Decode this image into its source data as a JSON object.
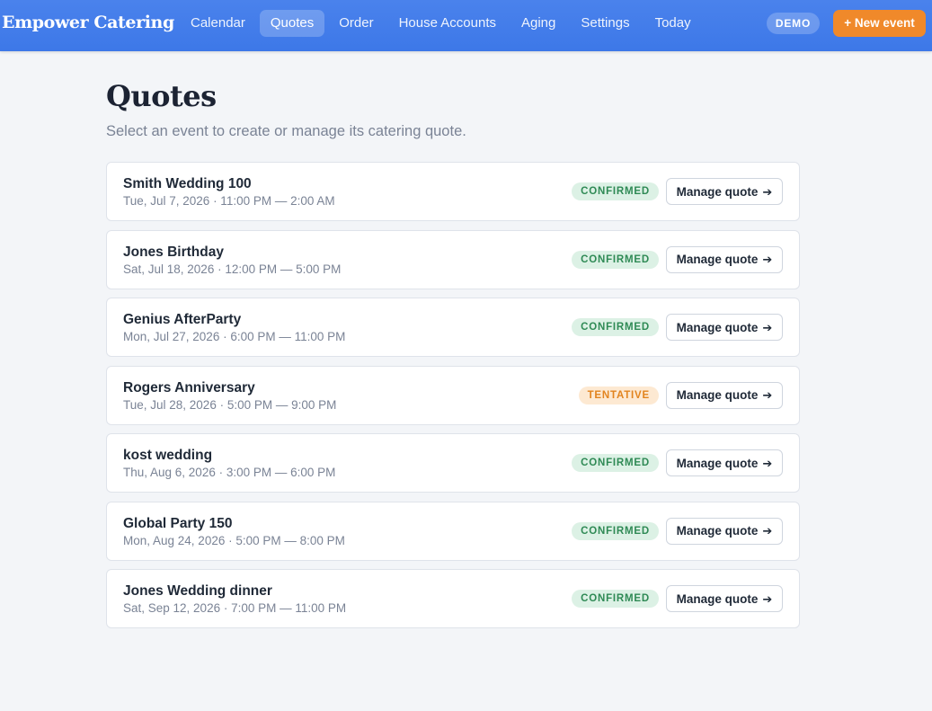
{
  "app": {
    "brand": "Empower Catering",
    "nav": [
      "Calendar",
      "Quotes",
      "Order",
      "House Accounts",
      "Aging",
      "Settings",
      "Today"
    ],
    "active_nav": "Quotes",
    "demo_badge": "DEMO",
    "new_event_label": "+ New event"
  },
  "page": {
    "title": "Quotes",
    "subtitle": "Select an event to create or manage its catering quote."
  },
  "manage_label": "Manage quote",
  "events": [
    {
      "name": "Smith Wedding 100",
      "date": "Tue, Jul 7, 2026 · 11:00 PM — 2:00 AM",
      "status": "CONFIRMED"
    },
    {
      "name": "Jones Birthday",
      "date": "Sat, Jul 18, 2026 · 12:00 PM — 5:00 PM",
      "status": "CONFIRMED"
    },
    {
      "name": "Genius AfterParty",
      "date": "Mon, Jul 27, 2026 · 6:00 PM — 11:00 PM",
      "status": "CONFIRMED"
    },
    {
      "name": "Rogers Anniversary",
      "date": "Tue, Jul 28, 2026 · 5:00 PM — 9:00 PM",
      "status": "TENTATIVE"
    },
    {
      "name": "kost wedding",
      "date": "Thu, Aug 6, 2026 · 3:00 PM — 6:00 PM",
      "status": "CONFIRMED"
    },
    {
      "name": "Global Party 150",
      "date": "Mon, Aug 24, 2026 · 5:00 PM — 8:00 PM",
      "status": "CONFIRMED"
    },
    {
      "name": "Jones Wedding dinner",
      "date": "Sat, Sep 12, 2026 · 7:00 PM — 11:00 PM",
      "status": "CONFIRMED"
    }
  ],
  "colors": {
    "header": "#3d78e8",
    "accent": "#f0892a",
    "confirmed": "#2f8a55",
    "tentative": "#e2841f"
  },
  "icons": {
    "manage_arrow": "arrow-right-icon"
  }
}
